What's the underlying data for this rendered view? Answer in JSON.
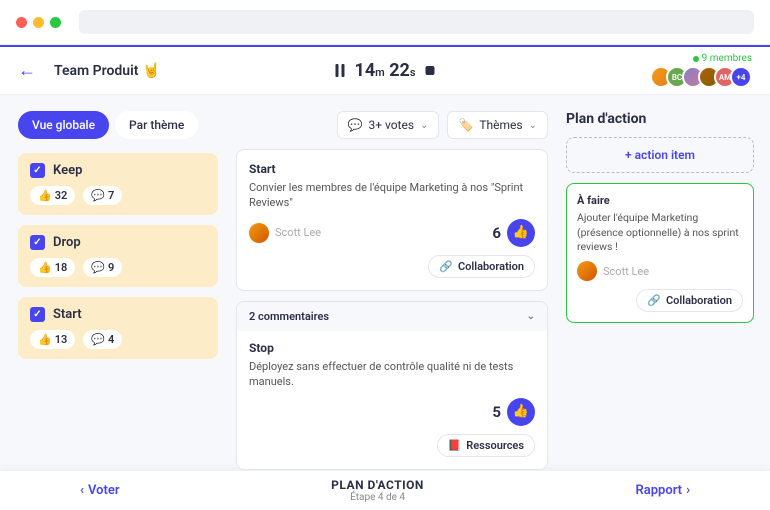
{
  "header": {
    "team_name": "Team Produit",
    "team_emoji": "🤘",
    "timer_min": "14",
    "timer_min_unit": "m",
    "timer_sec": "22",
    "timer_sec_unit": "s",
    "members_label": "9 membres",
    "overflow_avatar": "+4",
    "avatar_initials": [
      "",
      "BC",
      "",
      "",
      "AM"
    ]
  },
  "tabs": {
    "global": "Vue globale",
    "by_theme": "Par thème"
  },
  "categories": [
    {
      "name": "Keep",
      "likes": 32,
      "comments": 7
    },
    {
      "name": "Drop",
      "likes": 18,
      "comments": 9
    },
    {
      "name": "Start",
      "likes": 13,
      "comments": 4
    }
  ],
  "filters": {
    "votes": "3+ votes",
    "themes": "Thèmes"
  },
  "cards": [
    {
      "title": "Start",
      "desc": "Convier les membres de l'équipe Marketing à nos \"Sprint Reviews\"",
      "author": "Scott Lee",
      "votes": 6,
      "tag": "Collaboration"
    },
    {
      "comments_label": "2 commentaires",
      "title": "Stop",
      "desc": "Déployez sans effectuer de contrôle qualité ni de tests manuels.",
      "votes": 5,
      "tag": "Ressources"
    }
  ],
  "plan": {
    "title": "Plan d'action",
    "add_label": "action item",
    "todo_title": "À faire",
    "todo_desc": "Ajouter l'équipe Marketing (présence optionnelle) à nos sprint reviews !",
    "todo_author": "Scott Lee",
    "todo_tag": "Collaboration"
  },
  "footer": {
    "prev": "Voter",
    "center_title": "PLAN D'ACTION",
    "center_sub": "Étape 4 de 4",
    "next": "Rapport"
  }
}
